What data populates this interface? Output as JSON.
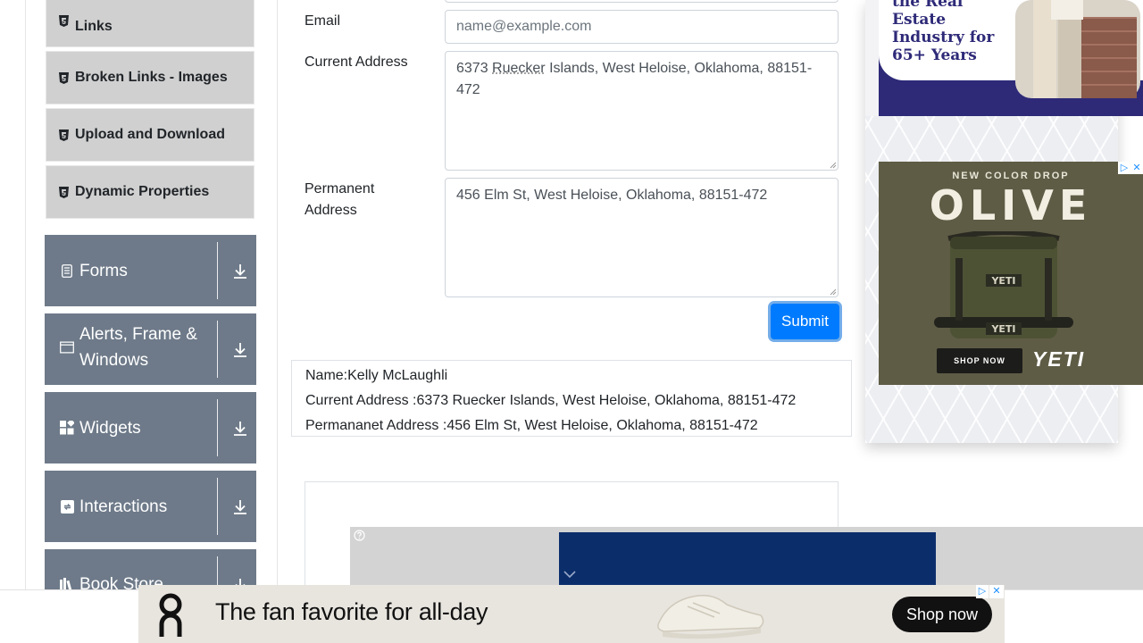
{
  "sidebar": {
    "elements_items": [
      {
        "label": "Links"
      },
      {
        "label": "Broken Links - Images"
      },
      {
        "label": "Upload and Download"
      },
      {
        "label": "Dynamic Properties"
      }
    ],
    "groups": [
      {
        "label": "Forms"
      },
      {
        "label": "Alerts, Frame &\nWindows"
      },
      {
        "label": "Widgets"
      },
      {
        "label": "Interactions"
      },
      {
        "label": "Book Store"
      }
    ]
  },
  "form": {
    "email": {
      "label": "Email",
      "placeholder": "name@example.com",
      "value": ""
    },
    "current_address": {
      "label": "Current Address",
      "value_part1": "6373 ",
      "value_part2": "Ruecker",
      "value_part3": " Islands, West Heloise, Oklahoma, 88151-472"
    },
    "permanent_address": {
      "label": "Permanent\nAddress",
      "value": "456 Elm St, West Heloise, Oklahoma, 88151-472"
    },
    "submit_label": "Submit"
  },
  "output": {
    "name": "Name:Kelly McLaughli",
    "current_address": "Current Address :6373 Ruecker Islands, West Heloise, Oklahoma, 88151-472",
    "permanent_address": "Permananet Address :456 Elm St, West Heloise, Oklahoma, 88151-472"
  },
  "ads": {
    "top_right": {
      "text": "the Real Estate Industry for 65+ Years"
    },
    "yeti": {
      "kicker": "NEW COLOR DROP",
      "headline": "OLIVE",
      "cta": "SHOP NOW",
      "brand": "YETI",
      "bag_label": "YETI"
    },
    "banner": {
      "logo": "on",
      "text": "The fan favorite for all-day",
      "cta": "Shop now"
    }
  },
  "colors": {
    "sidebar_group_bg": "#6e7a89",
    "sidebar_item_bg": "#d0d0d0",
    "submit_bg": "#007bff"
  }
}
